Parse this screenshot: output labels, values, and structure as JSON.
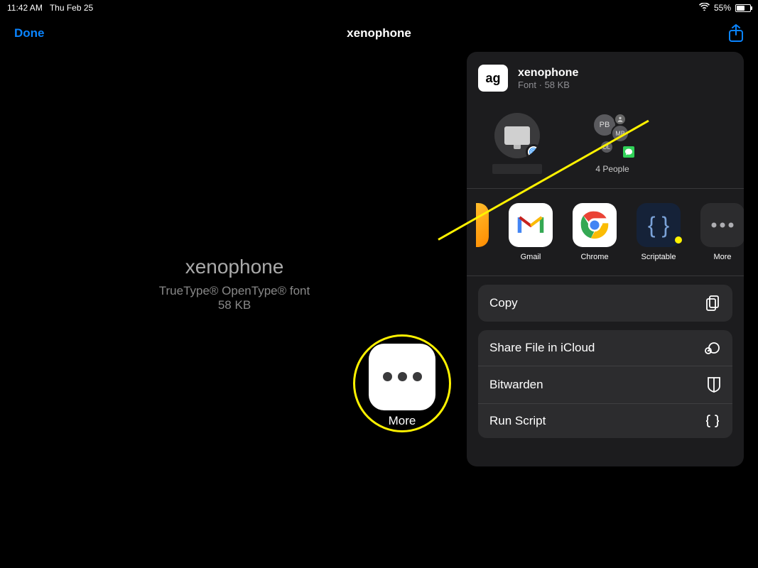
{
  "statusbar": {
    "time": "11:42 AM",
    "date": "Thu Feb 25",
    "battery_pct": "55%"
  },
  "nav": {
    "done": "Done",
    "title": "xenophone"
  },
  "content": {
    "title": "xenophone",
    "type_line": "TrueType® OpenType® font",
    "size": "58 KB"
  },
  "share": {
    "file_name": "xenophone",
    "file_subtitle": "Font · 58 KB",
    "file_icon_text": "ag",
    "airdrop_group_label": "4 People",
    "contacts": {
      "pb": "PB",
      "mb": "MB",
      "dl": "DL"
    },
    "apps": [
      {
        "label": ""
      },
      {
        "label": "Gmail"
      },
      {
        "label": "Chrome"
      },
      {
        "label": "Scriptable"
      },
      {
        "label": "More"
      }
    ],
    "actions": {
      "copy": "Copy",
      "share_icloud": "Share File in iCloud",
      "bitwarden": "Bitwarden",
      "run_script": "Run Script"
    }
  },
  "callout": {
    "label": "More"
  }
}
